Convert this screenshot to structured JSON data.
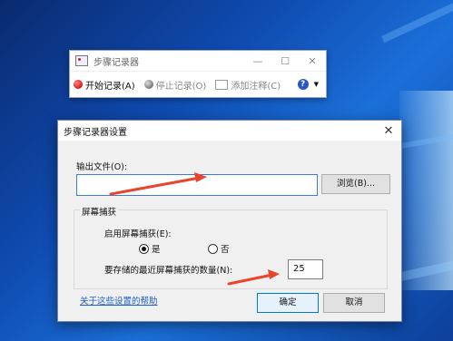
{
  "recorder": {
    "title": "步骤记录器",
    "controls": {
      "minimize": "—",
      "maximize": "☐",
      "close": "✕"
    },
    "start_label": "开始记录(A)",
    "stop_label": "停止记录(O)",
    "comment_label": "添加注释(C)"
  },
  "dialog": {
    "title": "步骤记录器设置",
    "output_file_label": "输出文件(O):",
    "output_file_value": "",
    "browse_label": "浏览(B)...",
    "group_title": "屏幕捕获",
    "enable_capture_label": "启用屏幕捕获(E):",
    "yes_label": "是",
    "no_label": "否",
    "enable_capture_selected": "是",
    "recent_count_label": "要存储的最近屏幕捕获的数量(N):",
    "recent_count_value": "25",
    "help_link": "关于这些设置的帮助",
    "ok_label": "确定",
    "cancel_label": "取消"
  },
  "annotations": {
    "arrow_color": "#e8452c"
  }
}
